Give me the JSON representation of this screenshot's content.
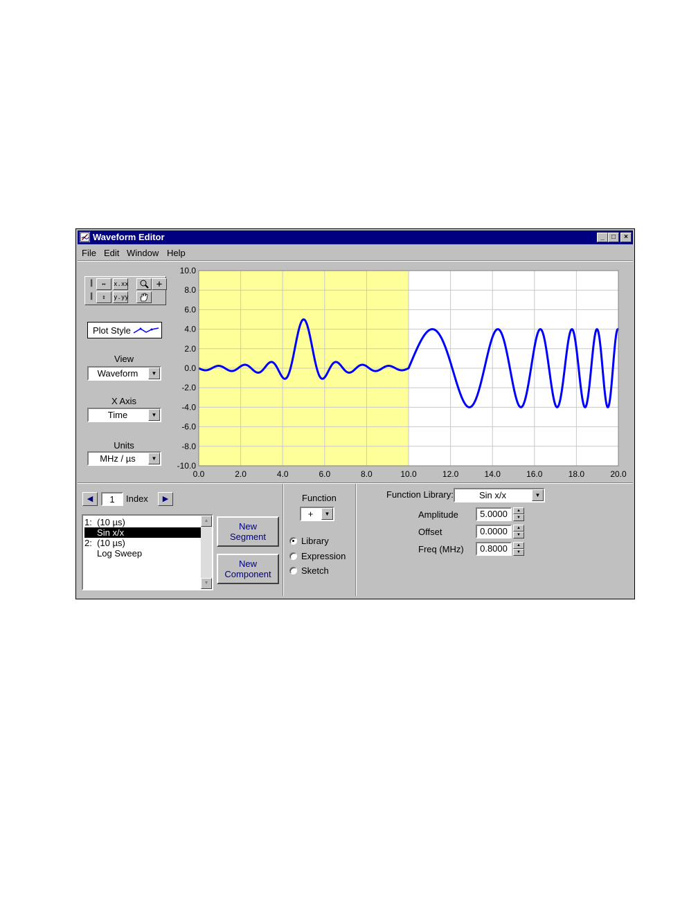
{
  "window": {
    "title": "Waveform Editor",
    "controls": {
      "minimize": "_",
      "maximize": "□",
      "close": "×"
    }
  },
  "menu": [
    "File",
    "Edit",
    "Window",
    "Help"
  ],
  "left_panel": {
    "tool_palette": [
      "x-autoscale",
      "x-format",
      "zoom",
      "cursor",
      "y-autoscale",
      "y-format",
      "pan"
    ],
    "plot_style_label": "Plot Style",
    "view": {
      "label": "View",
      "value": "Waveform"
    },
    "x_axis": {
      "label": "X Axis",
      "value": "Time"
    },
    "units": {
      "label": "Units",
      "value": "MHz / µs"
    }
  },
  "chart_data": {
    "type": "line",
    "title": "",
    "xlabel": "",
    "ylabel": "",
    "xlim": [
      0,
      20
    ],
    "ylim": [
      -10,
      10
    ],
    "x_ticks": [
      "0.0",
      "2.0",
      "4.0",
      "6.0",
      "8.0",
      "10.0",
      "12.0",
      "14.0",
      "16.0",
      "18.0",
      "20.0"
    ],
    "y_ticks": [
      "10.0",
      "8.0",
      "6.0",
      "4.0",
      "2.0",
      "0.0",
      "-2.0",
      "-4.0",
      "-6.0",
      "-8.0",
      "-10.0"
    ],
    "grid": true,
    "highlight_region": {
      "x": [
        0,
        10
      ],
      "color": "#ffff99"
    },
    "plot_background": "#ffffff",
    "series": [
      {
        "color": "#0000ff",
        "segments": [
          {
            "function": "Sin x/x",
            "x_range": [
              0,
              10
            ],
            "center": 5.0,
            "amplitude": 5.0,
            "freq_mhz": 0.8
          },
          {
            "function": "Log Sweep",
            "x_range": [
              10,
              20
            ],
            "amplitude": 4.0,
            "start_freq_mhz": 0.2,
            "end_freq_mhz": 1.1
          }
        ]
      }
    ]
  },
  "segment_panel": {
    "index": "1",
    "index_label": "Index",
    "list_items": [
      {
        "text": "1:  (10 µs)",
        "selected": false
      },
      {
        "text": "     Sin x/x",
        "selected": true
      },
      {
        "text": "2:  (10 µs)",
        "selected": false
      },
      {
        "text": "     Log Sweep",
        "selected": false
      }
    ],
    "new_segment_button": [
      "New",
      "Segment"
    ],
    "new_component_button": [
      "New",
      "Component"
    ]
  },
  "function_panel": {
    "label": "Function",
    "operator": "+",
    "radios": [
      {
        "label": "Library",
        "selected": true
      },
      {
        "label": "Expression",
        "selected": false
      },
      {
        "label": "Sketch",
        "selected": false
      }
    ]
  },
  "library_panel": {
    "function_library_label": "Function Library:",
    "function_library_value": "Sin x/x",
    "params": [
      {
        "label": "Amplitude",
        "value": "5.0000"
      },
      {
        "label": "Offset",
        "value": "0.0000"
      },
      {
        "label": "Freq (MHz)",
        "value": "0.8000"
      }
    ]
  },
  "colors": {
    "title_bar": "#000080",
    "face": "#c0c0c0",
    "trace": "#0000ff",
    "highlight": "#ffff99"
  }
}
